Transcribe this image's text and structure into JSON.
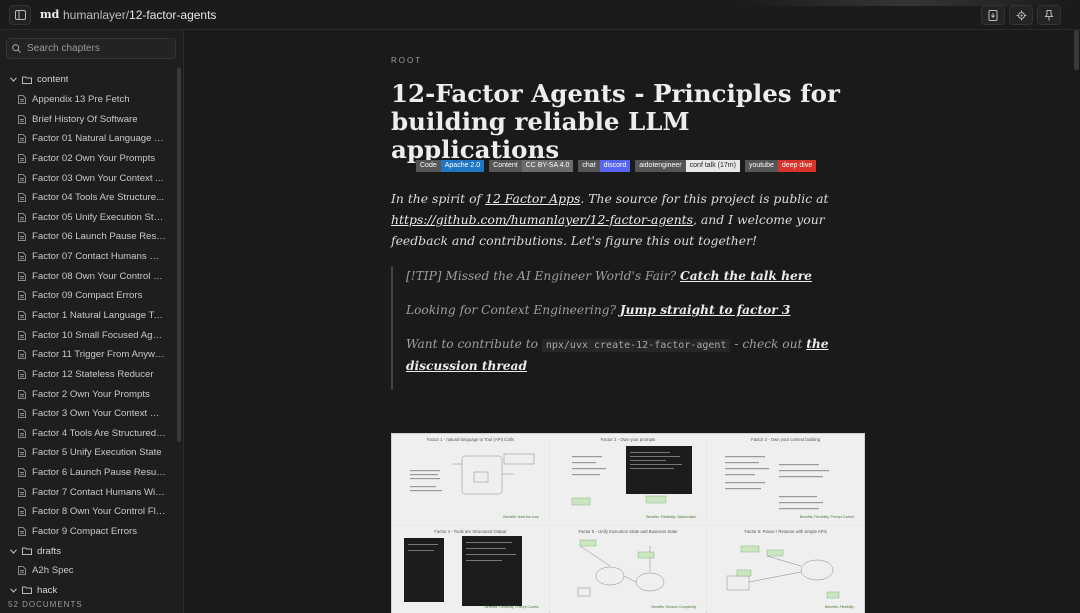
{
  "header": {
    "logo": "md",
    "breadcrumb_owner": "humanlayer/",
    "breadcrumb_repo": "12-factor-agents"
  },
  "sidebar": {
    "search_placeholder": "Search chapters",
    "footer": "52 DOCUMENTS",
    "items": [
      {
        "type": "folder",
        "label": "content"
      },
      {
        "type": "file",
        "label": "Appendix 13 Pre Fetch"
      },
      {
        "type": "file",
        "label": "Brief History Of Software"
      },
      {
        "type": "file",
        "label": "Factor 01 Natural Language To..."
      },
      {
        "type": "file",
        "label": "Factor 02 Own Your Prompts"
      },
      {
        "type": "file",
        "label": "Factor 03 Own Your Context ..."
      },
      {
        "type": "file",
        "label": "Factor 04 Tools Are Structure..."
      },
      {
        "type": "file",
        "label": "Factor 05 Unify Execution State"
      },
      {
        "type": "file",
        "label": "Factor 06 Launch Pause Resu..."
      },
      {
        "type": "file",
        "label": "Factor 07 Contact Humans Wit..."
      },
      {
        "type": "file",
        "label": "Factor 08 Own Your Control Fl..."
      },
      {
        "type": "file",
        "label": "Factor 09 Compact Errors"
      },
      {
        "type": "file",
        "label": "Factor 1 Natural Language To ..."
      },
      {
        "type": "file",
        "label": "Factor 10 Small Focused Agents"
      },
      {
        "type": "file",
        "label": "Factor 11 Trigger From Anywh..."
      },
      {
        "type": "file",
        "label": "Factor 12 Stateless Reducer"
      },
      {
        "type": "file",
        "label": "Factor 2 Own Your Prompts"
      },
      {
        "type": "file",
        "label": "Factor 3 Own Your Context Wi..."
      },
      {
        "type": "file",
        "label": "Factor 4 Tools Are Structured ..."
      },
      {
        "type": "file",
        "label": "Factor 5 Unify Execution State"
      },
      {
        "type": "file",
        "label": "Factor 6 Launch Pause Resume"
      },
      {
        "type": "file",
        "label": "Factor 7 Contact Humans With..."
      },
      {
        "type": "file",
        "label": "Factor 8 Own Your Control Flow"
      },
      {
        "type": "file",
        "label": "Factor 9 Compact Errors"
      },
      {
        "type": "folder",
        "label": "drafts"
      },
      {
        "type": "file",
        "label": "A2h Spec"
      },
      {
        "type": "folder",
        "label": "hack"
      }
    ]
  },
  "doc": {
    "root_label": "ROOT",
    "title": "12-Factor Agents - Principles for building reliable LLM applications",
    "badges": [
      {
        "k": "Code",
        "v": "Apache 2.0",
        "color": "#1f77c4"
      },
      {
        "k": "Content",
        "v": "CC BY-SA 4.0",
        "color": "#6b6b6b"
      },
      {
        "k": "chat",
        "v": "discord",
        "color": "#5865f2"
      },
      {
        "k": "aidotengineer",
        "v": "conf talk (17m)",
        "color": "#e8e8e8"
      },
      {
        "k": "youtube",
        "v": "deep dive",
        "color": "#d9342b"
      }
    ],
    "intro": {
      "t1": "In the spirit of ",
      "link1": "12 Factor Apps",
      "t2": ". The source for this project is public at ",
      "link2": "https://github.com/humanlayer/12-factor-agents",
      "t3": ", and I welcome your feedback and contributions. Let's figure this out together!"
    },
    "quote": {
      "p1_text": "[!TIP] Missed the AI Engineer World's Fair? ",
      "p1_link": "Catch the talk here",
      "p2_text": "Looking for Context Engineering? ",
      "p2_link": "Jump straight to factor 3",
      "p3_text": "Want to contribute to ",
      "p3_code": "npx/uvx create-12-factor-agent",
      "p3_mid": " - check out ",
      "p3_link": "the discussion thread"
    },
    "figure_panels": [
      {
        "title": "Factor 1 - natural language to Tool (API) Calls",
        "cap": "Benefits: finds the loop"
      },
      {
        "title": "Factor 2 - Own your prompts",
        "cap": "Benefits: Flexibility, Optimization"
      },
      {
        "title": "Factor 3 - Own your context building",
        "cap": "Benefits: Flexibility, Prompt Control"
      },
      {
        "title": "Factor 4 - Tools are Structured Output",
        "cap": "Benefits: Flexibility, Prompt Control"
      },
      {
        "title": "Factor 5 - Unify Execution State and Business State",
        "cap": "Benefits: Reduce Complexity"
      },
      {
        "title": "Factor 6: Pause / Resume with simple APIs",
        "cap": "Benefits: Flexibility"
      }
    ]
  }
}
